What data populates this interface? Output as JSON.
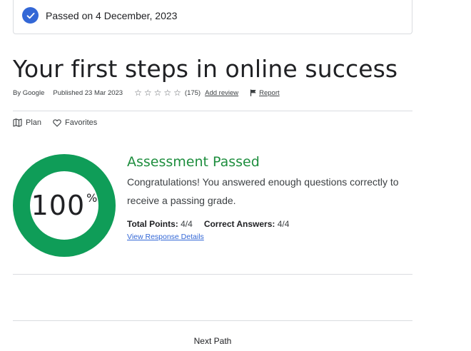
{
  "status_banner": {
    "text": "Passed on 4 December, 2023",
    "icon": "check-circle-icon",
    "color": "#3367d6"
  },
  "course": {
    "title": "Your first steps in online success",
    "author": "By Google",
    "published": "Published 23 Mar 2023",
    "rating_stars": 0,
    "rating_count": "(175)",
    "add_review_label": "Add review",
    "report_label": "Report"
  },
  "actions": {
    "plan_label": "Plan",
    "favorites_label": "Favorites"
  },
  "assessment": {
    "score_value": "100",
    "score_unit": "%",
    "score_fraction": 1.0,
    "ring_color": "#0f9d58",
    "title": "Assessment Passed",
    "title_color": "#1e8e3e",
    "description": "Congratulations! You answered enough questions correctly to receive a passing grade.",
    "total_points_label": "Total Points:",
    "total_points_value": "4/4",
    "correct_answers_label": "Correct Answers:",
    "correct_answers_value": "4/4",
    "details_link": "View Response Details"
  },
  "footer": {
    "next_path_label": "Next Path"
  }
}
